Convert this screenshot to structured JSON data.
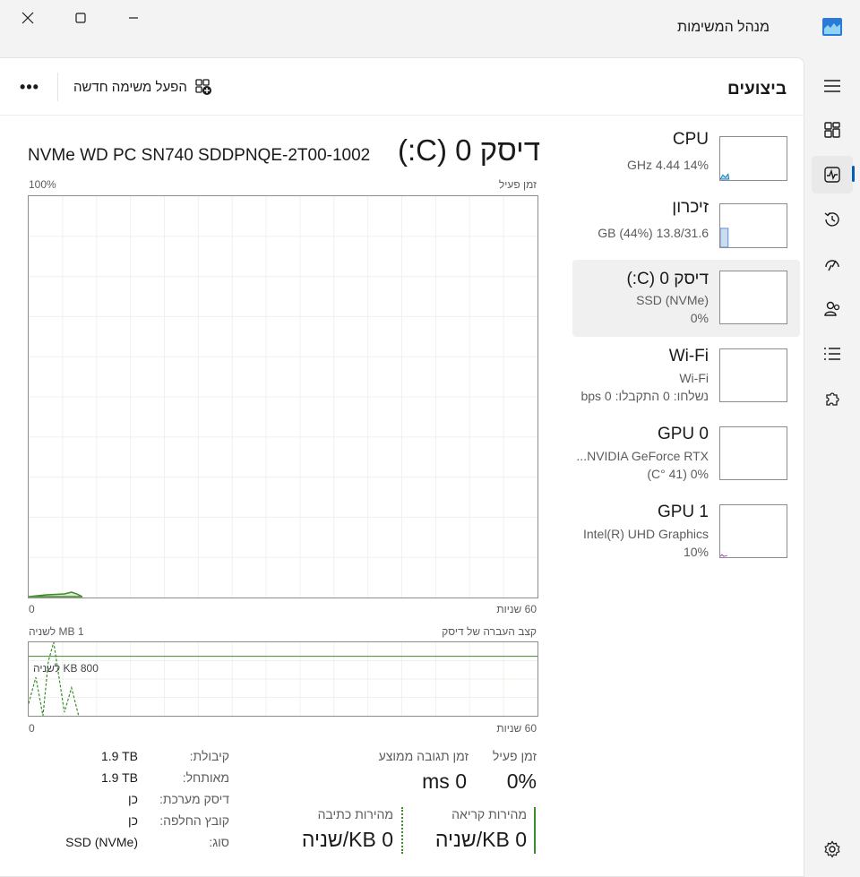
{
  "app": {
    "title": "מנהל המשימות"
  },
  "header": {
    "page_title": "ביצועים",
    "run_task_label": "הפעל משימה חדשה",
    "more_label": "•••"
  },
  "resources": [
    {
      "name": "CPU",
      "sub1": "14%  4.44 GHz",
      "sub2": ""
    },
    {
      "name": "זיכרון",
      "sub1": "13.8/31.6 GB (44%)",
      "sub2": ""
    },
    {
      "name": "דיסק 0 (C:)",
      "sub1": "SSD (NVMe)",
      "sub2": "0%"
    },
    {
      "name": "Wi-Fi",
      "sub1": "Wi-Fi",
      "sub2": "נשלחו: 0 התקבלו: 0 bps"
    },
    {
      "name": "GPU 0",
      "sub1": "NVIDIA GeForce RTX...",
      "sub2": "0% (41 °C)"
    },
    {
      "name": "GPU 1",
      "sub1": "Intel(R) UHD Graphics",
      "sub2": "10%"
    }
  ],
  "detail": {
    "title": "דיסק 0 (C:)",
    "model": "NVMe WD PC SN740 SDDPNQE-2T00-1002",
    "active_graph": {
      "label": "זמן פעיל",
      "max": "100%",
      "time_span": "60 שניות",
      "min": "0"
    },
    "transfer_graph": {
      "label": "קצב העברה של דיסק",
      "max": "1 MB לשניה",
      "mark": "800 KB לשניה",
      "time_span": "60 שניות",
      "min": "0"
    },
    "stats": {
      "active_time_label": "זמן פעיל",
      "active_time_value": "0%",
      "response_label": "זמן תגובה ממוצע",
      "response_value": "0 ms",
      "read_label": "מהירות קריאה",
      "read_value": "0 KB/שניה",
      "write_label": "מהירות כתיבה",
      "write_value": "0 KB/שניה"
    },
    "properties": [
      {
        "label": "קיבולת:",
        "value": "1.9 TB"
      },
      {
        "label": "מאותחל:",
        "value": "1.9 TB"
      },
      {
        "label": "דיסק מערכת:",
        "value": "כן"
      },
      {
        "label": "קובץ החלפה:",
        "value": "כן"
      },
      {
        "label": "סוג:",
        "value": "SSD (NVMe)"
      }
    ]
  },
  "colors": {
    "accent": "#005fb8",
    "disk_green": "#3f8a2c",
    "cpu_blue": "#117dbb",
    "memory_blue": "#8bb3e0",
    "gpu_purple": "#a43bc6"
  }
}
